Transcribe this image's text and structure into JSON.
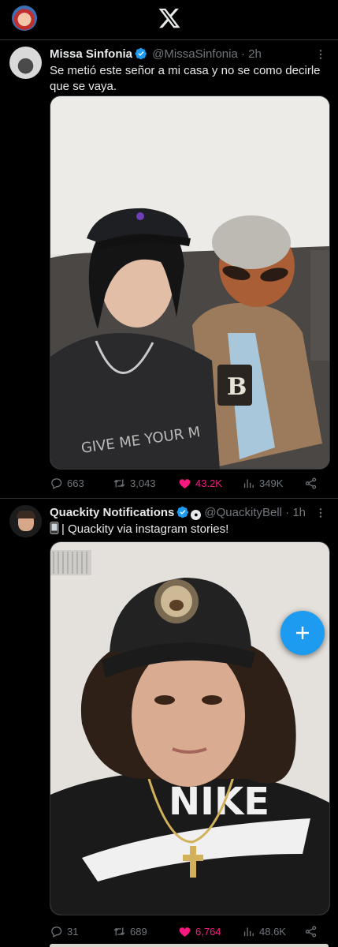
{
  "app": {
    "logo_icon": "x-logo-icon",
    "accent": "#1d9bf0"
  },
  "tweets": [
    {
      "name": "Missa Sinfonia",
      "handle": "@MissaSinfonia",
      "separator": "·",
      "time": "2h",
      "text": "Se metió este señor a mi casa y no se como decirle que se vaya.",
      "stats": {
        "replies": "663",
        "retweets": "3,043",
        "likes": "43.2K",
        "views": "349K"
      },
      "liked": true
    },
    {
      "name": "Quackity Notifications",
      "handle": "@QuackityBell",
      "separator": "·",
      "time": "1h",
      "text": "| Quackity via instagram stories!",
      "stats": {
        "replies": "31",
        "retweets": "689",
        "likes": "6,764",
        "views": "48.6K"
      },
      "liked": true
    }
  ],
  "colors": {
    "like": "#f91880",
    "muted": "#71767b",
    "text": "#e7e9ea",
    "divider": "#2f3336"
  }
}
